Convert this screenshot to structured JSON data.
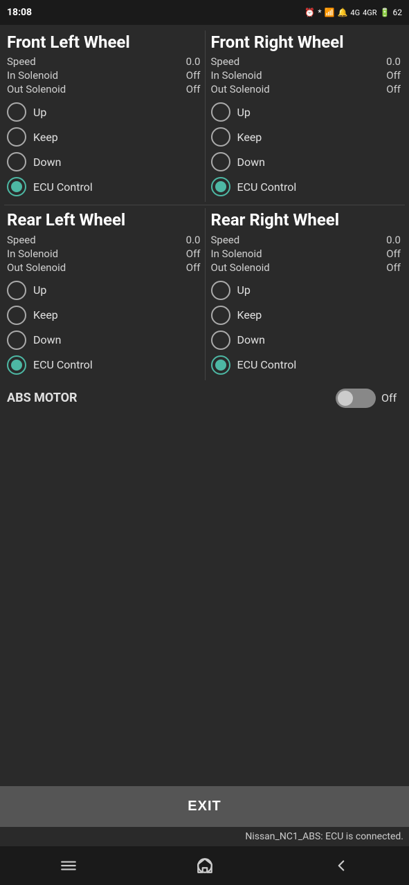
{
  "statusBar": {
    "time": "18:08",
    "batteryPercent": "62"
  },
  "wheels": [
    {
      "id": "front-left",
      "title": "Front Left Wheel",
      "speed": "0.0",
      "inSolenoid": "Off",
      "outSolenoid": "Off",
      "options": [
        "Up",
        "Keep",
        "Down",
        "ECU Control"
      ],
      "selected": "ECU Control"
    },
    {
      "id": "front-right",
      "title": "Front Right Wheel",
      "speed": "0.0",
      "inSolenoid": "Off",
      "outSolenoid": "Off",
      "options": [
        "Up",
        "Keep",
        "Down",
        "ECU Control"
      ],
      "selected": "ECU Control"
    },
    {
      "id": "rear-left",
      "title": "Rear Left Wheel",
      "speed": "0.0",
      "inSolenoid": "Off",
      "outSolenoid": "Off",
      "options": [
        "Up",
        "Keep",
        "Down",
        "ECU Control"
      ],
      "selected": "ECU Control"
    },
    {
      "id": "rear-right",
      "title": "Rear Right Wheel",
      "speed": "0.0",
      "inSolenoid": "Off",
      "outSolenoid": "Off",
      "options": [
        "Up",
        "Keep",
        "Down",
        "ECU Control"
      ],
      "selected": "ECU Control"
    }
  ],
  "absMotor": {
    "label": "ABS MOTOR",
    "value": "Off",
    "isOn": false
  },
  "exitButton": {
    "label": "EXIT"
  },
  "connectionStatus": "Nissan_NC1_ABS: ECU is connected.",
  "labels": {
    "speed": "Speed",
    "inSolenoid": "In Solenoid",
    "outSolenoid": "Out Solenoid"
  }
}
